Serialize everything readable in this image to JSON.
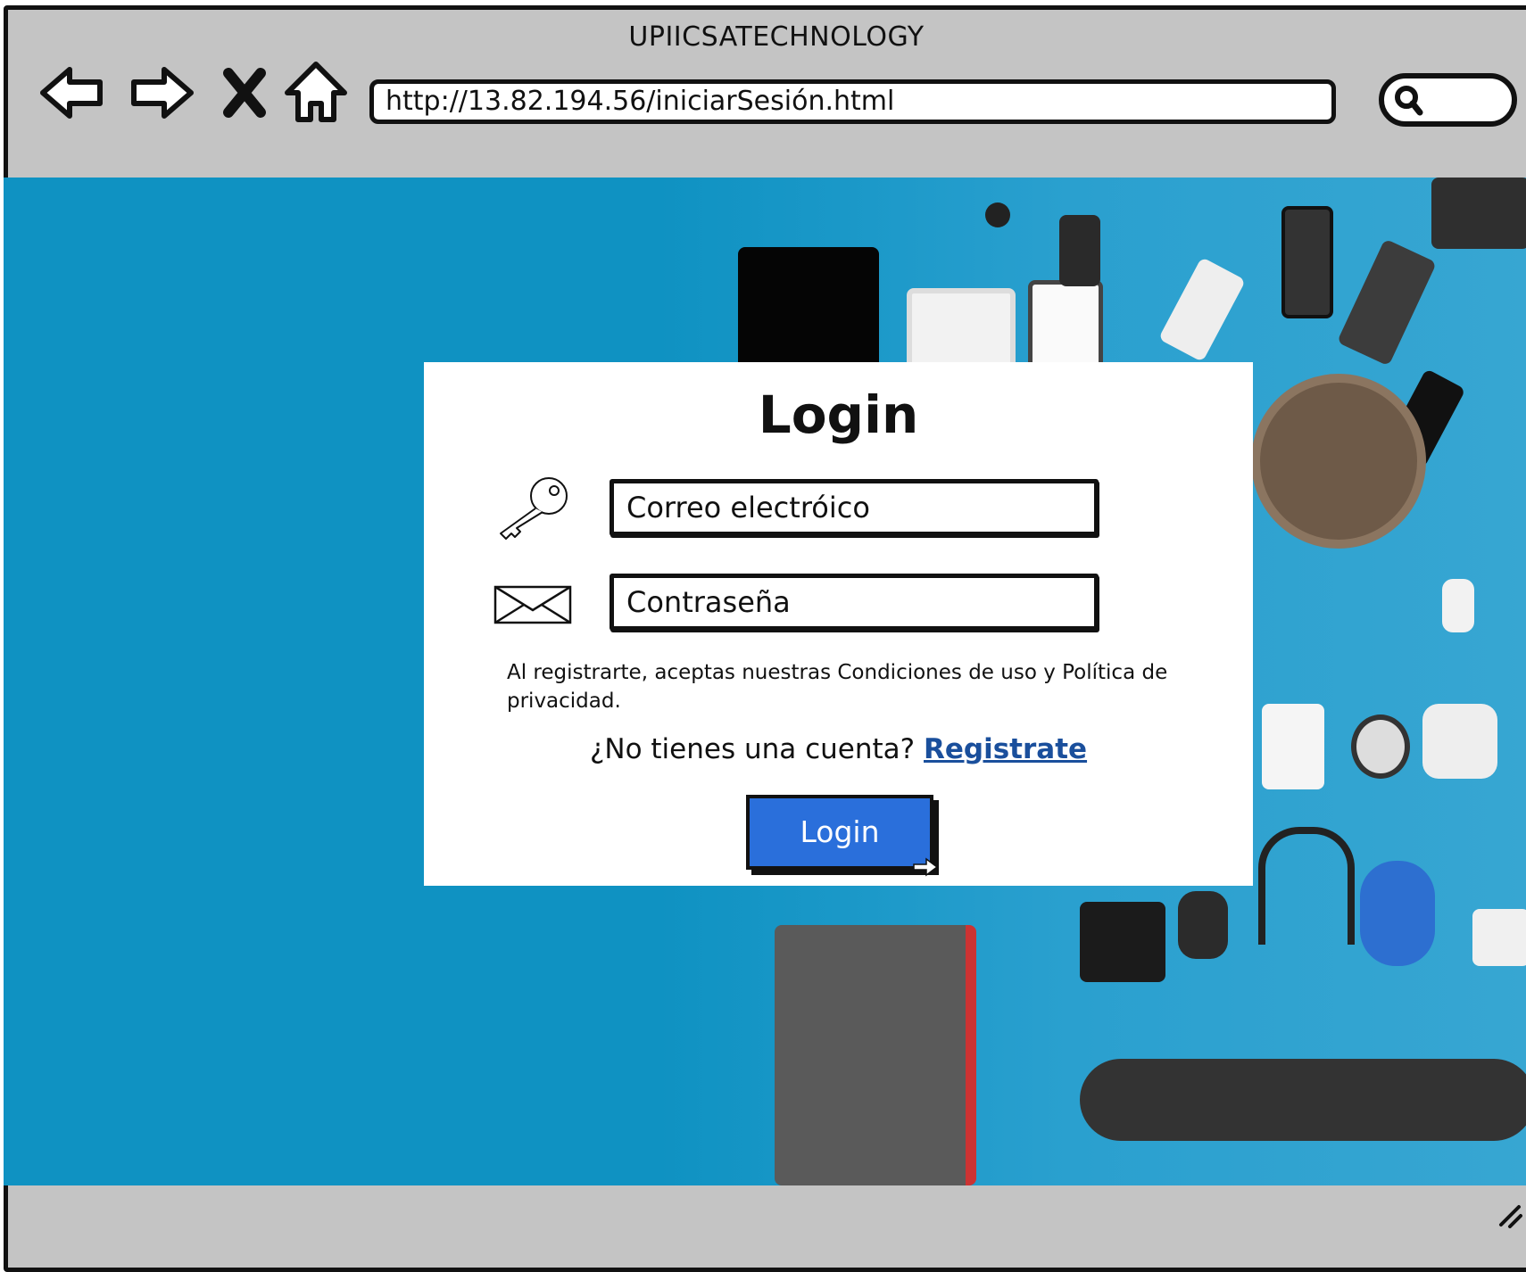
{
  "browser": {
    "title": "UPIICSATECHNOLOGY",
    "url": "http://13.82.194.56/iniciarSesión.html",
    "nav": {
      "back_icon": "arrow-left-icon",
      "forward_icon": "arrow-right-icon",
      "stop_icon": "close-icon",
      "home_icon": "home-icon"
    },
    "search_icon": "search-icon"
  },
  "login": {
    "title": "Login",
    "email_placeholder": "Correo electróico",
    "password_placeholder": "Contraseña",
    "key_icon": "key-icon",
    "envelope_icon": "envelope-icon",
    "terms": "Al registrarte, aceptas nuestras Condiciones de uso y Política de privacidad.",
    "no_account_text": "¿No tienes una cuenta?",
    "register_link": "Registrate",
    "login_button": "Login"
  },
  "colors": {
    "background_blue": "#0f92c2",
    "button_blue": "#2a6fdb",
    "link_blue": "#1a4f9c",
    "chrome_gray": "#c4c4c4"
  }
}
